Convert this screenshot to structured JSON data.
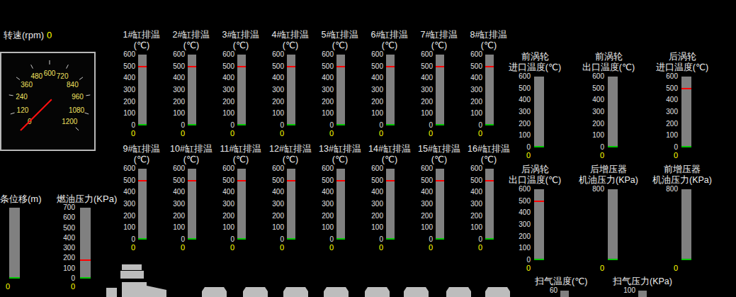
{
  "rpm": {
    "label": "转速(rpm)",
    "value": "0",
    "level": 0,
    "ticks": [
      "0",
      "120",
      "240",
      "360",
      "480",
      "600",
      "720",
      "840",
      "960",
      "1080",
      "1200"
    ]
  },
  "cylinder_scale": [
    "600",
    "500",
    "400",
    "300",
    "200",
    "100",
    "0"
  ],
  "cylinder_gauges": [
    {
      "title": "1#缸排温",
      "unit": "(℃)",
      "value": "0",
      "level": 0,
      "alarm": 0.8333
    },
    {
      "title": "2#缸排温",
      "unit": "(℃)",
      "value": "0",
      "level": 0,
      "alarm": 0.8333
    },
    {
      "title": "3#缸排温",
      "unit": "(℃)",
      "value": "0",
      "level": 0,
      "alarm": 0.8333
    },
    {
      "title": "4#缸排温",
      "unit": "(℃)",
      "value": "0",
      "level": 0,
      "alarm": 0.8333
    },
    {
      "title": "5#缸排温",
      "unit": "(℃)",
      "value": "0",
      "level": 0,
      "alarm": 0.8333
    },
    {
      "title": "6#缸排温",
      "unit": "(℃)",
      "value": "0",
      "level": 0,
      "alarm": 0.8333
    },
    {
      "title": "7#缸排温",
      "unit": "(℃)",
      "value": "0",
      "level": 0,
      "alarm": 0.8333
    },
    {
      "title": "8#缸排温",
      "unit": "(℃)",
      "value": "0",
      "level": 0,
      "alarm": 0.8333
    },
    {
      "title": "9#缸排温",
      "unit": "(℃)",
      "value": "0",
      "level": 0,
      "alarm": 0.8333
    },
    {
      "title": "10#缸排温",
      "unit": "(℃)",
      "value": "0",
      "level": 0,
      "alarm": 0.8333
    },
    {
      "title": "11#缸排温",
      "unit": "(℃)",
      "value": "0",
      "level": 0,
      "alarm": 0.8333
    },
    {
      "title": "12#缸排温",
      "unit": "(℃)",
      "value": "0",
      "level": 0,
      "alarm": 0.8333
    },
    {
      "title": "13#缸排温",
      "unit": "(℃)",
      "value": "0",
      "level": 0,
      "alarm": 0.8333
    },
    {
      "title": "14#缸排温",
      "unit": "(℃)",
      "value": "0",
      "level": 0,
      "alarm": 0.8333
    },
    {
      "title": "15#缸排温",
      "unit": "(℃)",
      "value": "0",
      "level": 0,
      "alarm": 0.8333
    },
    {
      "title": "16#缸排温",
      "unit": "(℃)",
      "value": "0",
      "level": 0,
      "alarm": 0.8333
    }
  ],
  "turbo_gauges": [
    {
      "title": "前涡轮",
      "subtitle": "进口温度(℃)",
      "ticks": [
        "600",
        "500",
        "400",
        "300",
        "200",
        "100",
        "0"
      ],
      "value": "0",
      "level": 0
    },
    {
      "title": "前涡轮",
      "subtitle": "出口温度(℃)",
      "ticks": [
        "600",
        "500",
        "400",
        "300",
        "200",
        "100",
        "0"
      ],
      "value": "0",
      "level": 0
    },
    {
      "title": "后涡轮",
      "subtitle": "进口温度(℃)",
      "ticks": [
        "600",
        "500",
        "400",
        "300",
        "200",
        "100",
        "0"
      ],
      "value": "0",
      "level": 0,
      "alarm": 0.8333
    },
    {
      "title": "后涡轮",
      "subtitle": "出口温度(℃)",
      "ticks": [
        "600",
        "500",
        "400",
        "300",
        "200",
        "100",
        "0"
      ],
      "value": "0",
      "level": 0,
      "alarm": 0.8333
    },
    {
      "title": "后增压器",
      "subtitle": "机油压力(KPa)",
      "ticks": [
        "800"
      ],
      "value": "0",
      "level": 0
    },
    {
      "title": "前增压器",
      "subtitle": "机油压力(KPa)",
      "ticks": [
        "800"
      ],
      "value": "0",
      "level": 0
    }
  ],
  "left_gauges": [
    {
      "title": "条位移(m)",
      "ticks": [],
      "value": "0",
      "level": 0
    },
    {
      "title": "燃油压力(KPa)",
      "ticks": [
        "700",
        "600",
        "500",
        "400",
        "300",
        "200",
        "100",
        "0"
      ],
      "value": "0",
      "level": 0,
      "alarm": 0.26
    }
  ],
  "bottom_gauges": [
    {
      "title": "扫气温度(℃)",
      "ticks": [
        "60"
      ]
    },
    {
      "title": "扫气压力(KPa)",
      "ticks": [
        "100"
      ]
    }
  ]
}
